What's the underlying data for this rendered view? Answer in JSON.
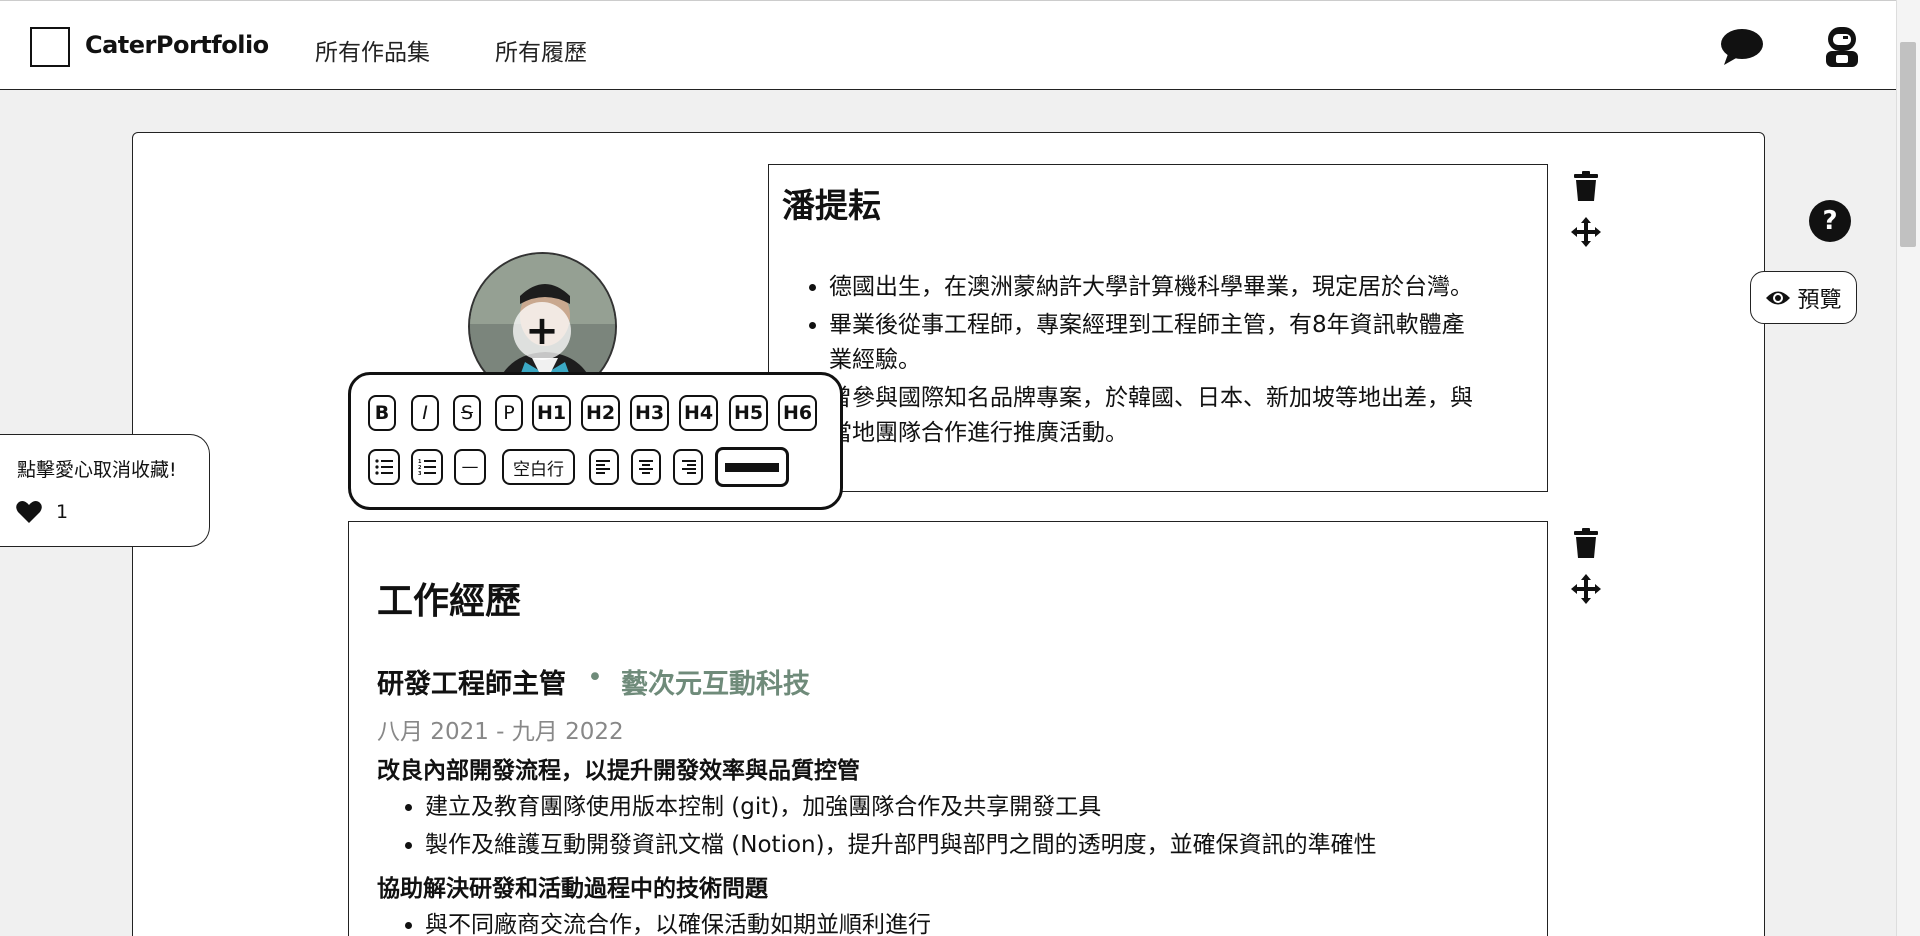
{
  "header": {
    "brand": "CaterPortfolio",
    "nav": [
      "所有作品集",
      "所有履歷"
    ],
    "chat_icon": "chat-bubble-icon",
    "user_icon": "robot-avatar-icon"
  },
  "profile": {
    "avatar_add_label": "+"
  },
  "bio": {
    "name": "潘提耘",
    "bullets": [
      "德國出生，在澳洲蒙納許大學計算機科學畢業，現定居於台灣。",
      "畢業後從事工程師，專案經理到工程師主管，有8年資訊軟體產業經驗。",
      "曾參與國際知名品牌專案，於韓國、日本、新加坡等地出差，與當地團隊合作進行推廣活動。"
    ]
  },
  "toolbar": {
    "row1": [
      "B",
      "I",
      "S",
      "P",
      "H1",
      "H2",
      "H3",
      "H4",
      "H5",
      "H6"
    ],
    "row2": [
      "bullet-list",
      "ordered-list",
      "—",
      "空白行",
      "align-left",
      "align-center",
      "align-right",
      "divider-line"
    ],
    "blank_line_label": "空白行",
    "hr_label": "—"
  },
  "actions": {
    "help_label": "?",
    "preview_label": "預覽"
  },
  "favorite": {
    "tooltip": "點擊愛心取消收藏!",
    "count": "1"
  },
  "work": {
    "section_title": "工作經歷",
    "job_title": "研發工程師主管",
    "separator": "•",
    "company": "藝次元互動科技",
    "dates": "八月 2021 - 九月 2022",
    "group1_heading": "改良內部開發流程，以提升開發效率與品質控管",
    "group1_items": [
      "建立及教育團隊使用版本控制 (git)，加強團隊合作及共享開發工具",
      "製作及維護互動開發資訊文檔 (Notion)，提升部門與部門之間的透明度，並確保資訊的準確性"
    ],
    "group2_heading": "協助解決研發和活動過程中的技術問題",
    "group2_items": [
      "與不同廠商交流合作，以確保活動如期並順利進行"
    ]
  },
  "colors": {
    "accent_company": "#6f8b7a",
    "date_gray": "#888888"
  }
}
